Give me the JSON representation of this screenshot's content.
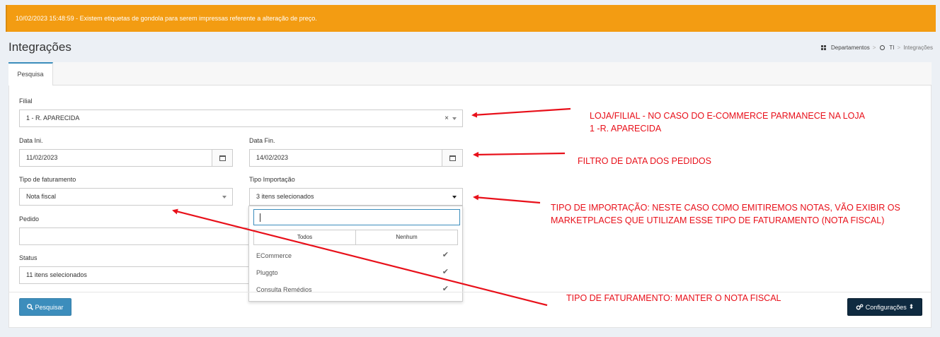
{
  "alert": {
    "text": "10/02/2023 15:48:59 - Existem etiquetas de gondola para serem impressas referente a alteração de preço."
  },
  "page": {
    "title": "Integrações"
  },
  "breadcrumb": {
    "item1": "Departamentos",
    "sep": ">",
    "item2": "TI",
    "item3": "Integrações"
  },
  "tabs": [
    {
      "label": "Pesquisa"
    }
  ],
  "form": {
    "filial": {
      "label": "Filial",
      "value": "1 - R. APARECIDA",
      "clear": "×"
    },
    "data_ini": {
      "label": "Data Ini.",
      "value": "11/02/2023"
    },
    "data_fin": {
      "label": "Data Fin.",
      "value": "14/02/2023"
    },
    "tipo_faturamento": {
      "label": "Tipo de faturamento",
      "value": "Nota fiscal"
    },
    "tipo_importacao": {
      "label": "Tipo Importação",
      "value": "3 itens selecionados"
    },
    "pedido": {
      "label": "Pedido",
      "value": ""
    },
    "status": {
      "label": "Status",
      "value": "11 itens selecionados"
    }
  },
  "dropdown": {
    "select_all": "Todos",
    "select_none": "Nenhum",
    "items": [
      {
        "label": "ECommerce",
        "checked": true
      },
      {
        "label": "Pluggto",
        "checked": true
      },
      {
        "label": "Consulta Remédios",
        "checked": true
      }
    ]
  },
  "buttons": {
    "search": "Pesquisar",
    "config": "Configurações"
  },
  "annotations": {
    "filial_line1": "LOJA/FILIAL - NO CASO DO E-COMMERCE PARMANECE NA LOJA",
    "filial_line2": "1 -R. APARECIDA",
    "data": "FILTRO DE DATA DOS PEDIDOS",
    "importacao_line1": "TIPO DE IMPORTAÇÃO: NESTE CASO COMO EMITIREMOS NOTAS, VÃO EXIBIR OS",
    "importacao_line2": "MARKETPLACES QUE UTILIZAM ESSE TIPO DE FATURAMENTO (NOTA FISCAL)",
    "faturamento": "TIPO DE FATURAMENTO: MANTER O NOTA FISCAL"
  },
  "colors": {
    "alert": "#f39c12",
    "primary": "#3c8dbc",
    "dark_button": "#0f2a40",
    "annotation": "#e8101a"
  }
}
